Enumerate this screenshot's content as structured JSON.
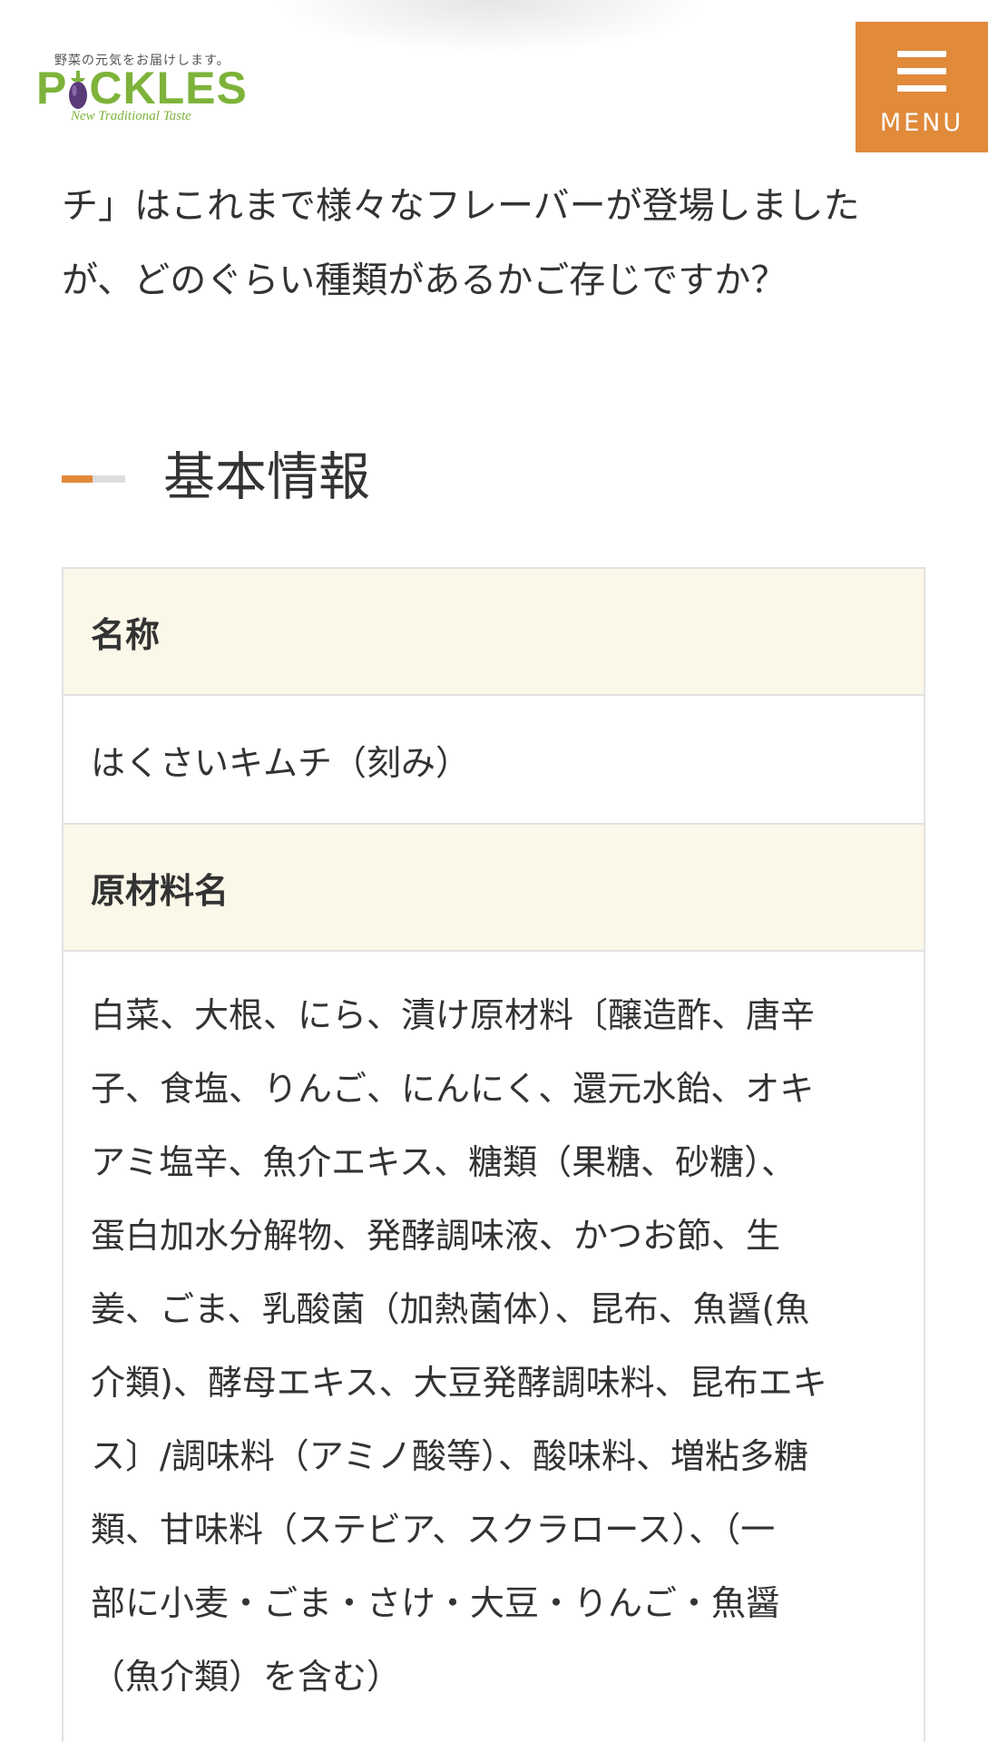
{
  "header": {
    "logo": {
      "tagline": "野菜の元気をお届けします。",
      "word_before": "P",
      "word_after": "CKLES",
      "subtitle": "New Traditional Taste"
    },
    "menu_label": "MENU"
  },
  "intro": {
    "lines": [
      "チ」はこれまで様々なフレーバーが登場しました",
      "が、どのぐらい種類があるかご存じですか？"
    ]
  },
  "section": {
    "title": "基本情報"
  },
  "info_table": [
    {
      "label": "名称",
      "value_lines": [
        "はくさいキムチ（刻み）"
      ]
    },
    {
      "label": "原材料名",
      "value_lines": [
        "白菜、大根、にら、漬け原材料〔醸造酢、唐辛",
        "子、食塩、りんご、にんにく、還元水飴、オキ",
        "アミ塩辛、魚介エキス、糖類（果糖、砂糖）、",
        "蛋白加水分解物、発酵調味液、かつお節、生",
        "姜、ごま、乳酸菌（加熱菌体）、昆布、魚醤(魚",
        "介類)、酵母エキス、大豆発酵調味料、昆布エキ",
        "ス〕/調味料（アミノ酸等）、酸味料、増粘多糖",
        "類、甘味料（ステビア、スクラロース）、（一",
        "部に小麦・ごま・さけ・大豆・りんご・魚醤",
        "（魚介類）を含む）"
      ]
    }
  ],
  "colors": {
    "accent": "#e08a3a",
    "logo_green": "#7db33a",
    "eggplant": "#5b3a78",
    "table_head_bg": "#fbf8e9",
    "border": "#e2e2e2",
    "text": "#333333"
  },
  "icons": {
    "menu": "hamburger-menu-icon",
    "logo_mark": "eggplant-icon"
  }
}
